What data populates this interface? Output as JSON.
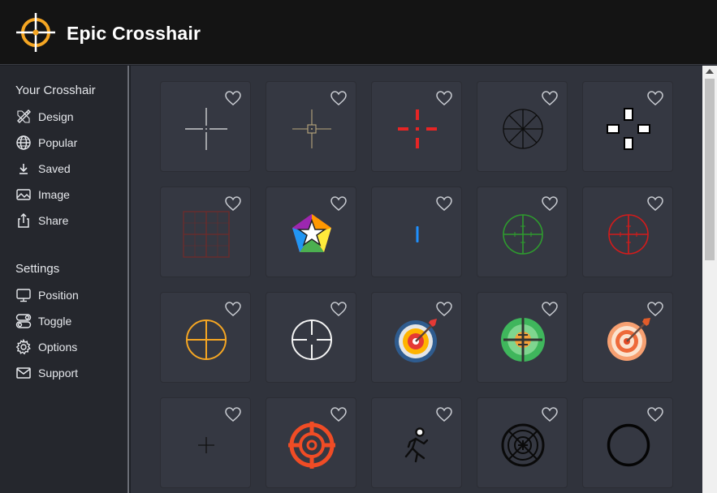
{
  "app": {
    "title": "Epic Crosshair",
    "accent": "#f5a623"
  },
  "sidebar": {
    "crosshair_title": "Your Crosshair",
    "crosshair_items": [
      {
        "label": "Design",
        "icon": "pencil-ruler-icon"
      },
      {
        "label": "Popular",
        "icon": "globe-icon"
      },
      {
        "label": "Saved",
        "icon": "download-icon"
      },
      {
        "label": "Image",
        "icon": "image-icon"
      },
      {
        "label": "Share",
        "icon": "share-icon"
      }
    ],
    "settings_title": "Settings",
    "settings_items": [
      {
        "label": "Position",
        "icon": "monitor-icon"
      },
      {
        "label": "Toggle",
        "icon": "toggle-icon"
      },
      {
        "label": "Options",
        "icon": "gear-icon"
      },
      {
        "label": "Support",
        "icon": "envelope-icon"
      }
    ]
  },
  "gallery": {
    "favorite_icon": "heart-icon",
    "crosshairs": [
      {
        "style": "thin-white-cross"
      },
      {
        "style": "tan-cross-box"
      },
      {
        "style": "red-dot-cross"
      },
      {
        "style": "black-starburst"
      },
      {
        "style": "white-block-cross"
      },
      {
        "style": "brown-grid-reticle"
      },
      {
        "style": "rainbow-star-pentagon"
      },
      {
        "style": "blue-line"
      },
      {
        "style": "green-scope"
      },
      {
        "style": "red-scope"
      },
      {
        "style": "orange-scope"
      },
      {
        "style": "white-scope"
      },
      {
        "style": "blue-dartboard-arrow"
      },
      {
        "style": "green-sniper-scope"
      },
      {
        "style": "orange-dartboard-arrow"
      },
      {
        "style": "small-black-plus"
      },
      {
        "style": "red-orange-target"
      },
      {
        "style": "running-figure"
      },
      {
        "style": "black-concentric-target"
      },
      {
        "style": "black-ring"
      }
    ]
  }
}
